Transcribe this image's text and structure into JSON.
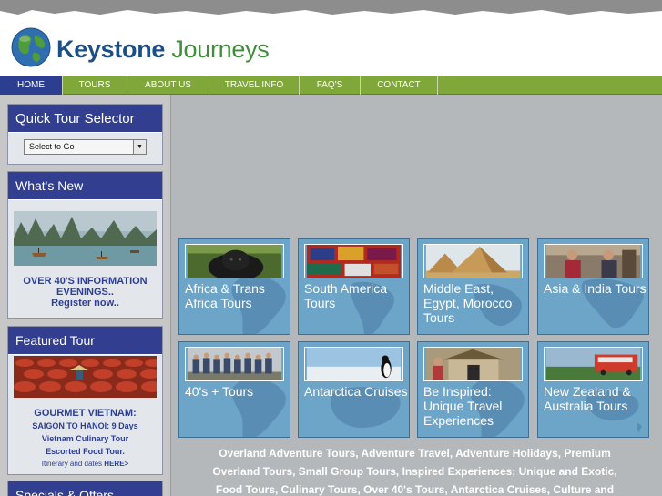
{
  "brand": {
    "name_primary": "Keystone",
    "name_secondary": "Journeys"
  },
  "nav": {
    "items": [
      {
        "label": "HOME",
        "active": true
      },
      {
        "label": "TOURS",
        "active": false
      },
      {
        "label": "ABOUT US",
        "active": false
      },
      {
        "label": "TRAVEL INFO",
        "active": false
      },
      {
        "label": "FAQ'S",
        "active": false
      },
      {
        "label": "CONTACT",
        "active": false
      }
    ]
  },
  "quick_tour": {
    "title": "Quick Tour Selector",
    "select_value": "Select to Go"
  },
  "whats_new": {
    "title": "What's New",
    "line1": "OVER 40'S INFORMATION",
    "line2": "EVENINGS..",
    "line3": "Register now.."
  },
  "featured": {
    "title": "Featured Tour",
    "heading": "GOURMET VIETNAM:",
    "line1": "SAIGON TO HANOI: 9 Days",
    "line2": "Vietnam Culinary Tour",
    "line3": "Escorted Food Tour.",
    "link_prefix": "Itinerary and dates",
    "link_label": "HERE>"
  },
  "specials": {
    "title": "Specials & Offers"
  },
  "tours": [
    {
      "label": "Africa & Trans Africa Tours",
      "image": "gorilla-photo"
    },
    {
      "label": "South America Tours",
      "image": "textiles-photo"
    },
    {
      "label": "Middle East, Egypt, Morocco Tours",
      "image": "pyramids-photo"
    },
    {
      "label": "Asia & India Tours",
      "image": "asia-people-photo"
    },
    {
      "label": "40's + Tours",
      "image": "group-photo"
    },
    {
      "label": "Antarctica Cruises",
      "image": "penguin-photo"
    },
    {
      "label": "Be Inspired: Unique Travel Experiences",
      "image": "hut-photo"
    },
    {
      "label": "New Zealand & Australia Tours",
      "image": "bus-photo"
    }
  ],
  "seo": {
    "line1": "Overland Adventure Tours, Adventure Travel, Adventure Holidays, Premium",
    "line2": "Overland Tours, Small Group Tours, Inspired Experiences; Unique and Exotic,",
    "line3": "Food Tours, Culinary Tours,  Over 40's Tours, Antarctica Cruises, Culture and"
  },
  "colors": {
    "nav_green": "#7fa73a",
    "panel_navy": "#323e8f",
    "card_blue": "#6da5c8",
    "brand_blue": "#1b4f86",
    "brand_green": "#3f8e3a"
  }
}
